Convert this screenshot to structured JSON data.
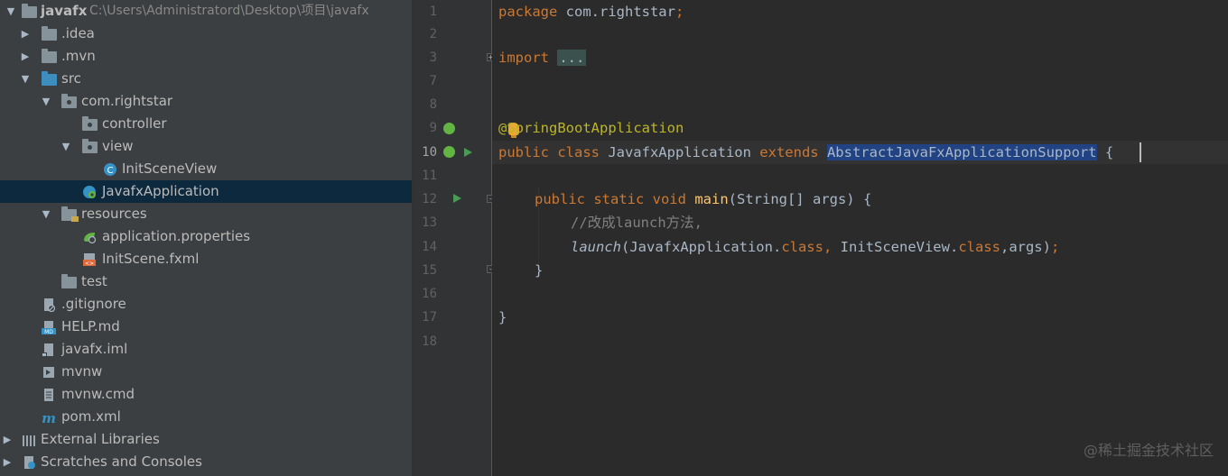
{
  "project": {
    "root_name": "javafx",
    "root_path": "C:\\Users\\Administratord\\Desktop\\项目\\javafx",
    "items": [
      {
        "label": ".idea"
      },
      {
        "label": ".mvn"
      },
      {
        "label": "src"
      },
      {
        "label": "com.rightstar"
      },
      {
        "label": "controller"
      },
      {
        "label": "view"
      },
      {
        "label": "InitSceneView"
      },
      {
        "label": "JavafxApplication"
      },
      {
        "label": "resources"
      },
      {
        "label": "application.properties"
      },
      {
        "label": "InitScene.fxml"
      },
      {
        "label": "test"
      },
      {
        "label": ".gitignore"
      },
      {
        "label": "HELP.md"
      },
      {
        "label": "javafx.iml"
      },
      {
        "label": "mvnw"
      },
      {
        "label": "mvnw.cmd"
      },
      {
        "label": "pom.xml"
      },
      {
        "label": "External Libraries"
      },
      {
        "label": "Scratches and Consoles"
      }
    ]
  },
  "editor": {
    "line_numbers": [
      "1",
      "2",
      "3",
      "7",
      "8",
      "9",
      "10",
      "11",
      "12",
      "13",
      "14",
      "15",
      "16",
      "17",
      "18"
    ],
    "tokens": {
      "l1_kw": "package",
      "l1_rest": " com.rightstar",
      "l1_semi": ";",
      "l3_kw": "import",
      "l3_fold": "...",
      "l9_at": "@",
      "l9_ann": "SpringBootApplication",
      "l10_kw1": "public class",
      "l10_name": " JavafxApplication ",
      "l10_kw2": "extends",
      "l10_sel": "AbstractJavaFxApplicationSupport",
      "l10_brace": " {",
      "l12_kw": "public static void",
      "l12_fn": "main",
      "l12_rest": "(String[] args) {",
      "l13_comment": "//改成launch方法,",
      "l14_fn": "launch",
      "l14_a": "(JavafxApplication.",
      "l14_kw1": "class",
      "l14_comma": ",",
      "l14_b": " InitSceneView.",
      "l14_kw2": "class",
      "l14_c": ",args)",
      "l14_semi": ";",
      "l15_close": "}",
      "l17_close": "}"
    }
  },
  "watermark": "@稀土掘金技术社区",
  "colors": {
    "panel_bg": "#3c3f41",
    "editor_bg": "#2b2b2b",
    "keyword": "#cc7832",
    "annotation": "#bbb529",
    "method": "#ffc66d",
    "selection": "#214283",
    "selected_row": "#0d293e"
  }
}
